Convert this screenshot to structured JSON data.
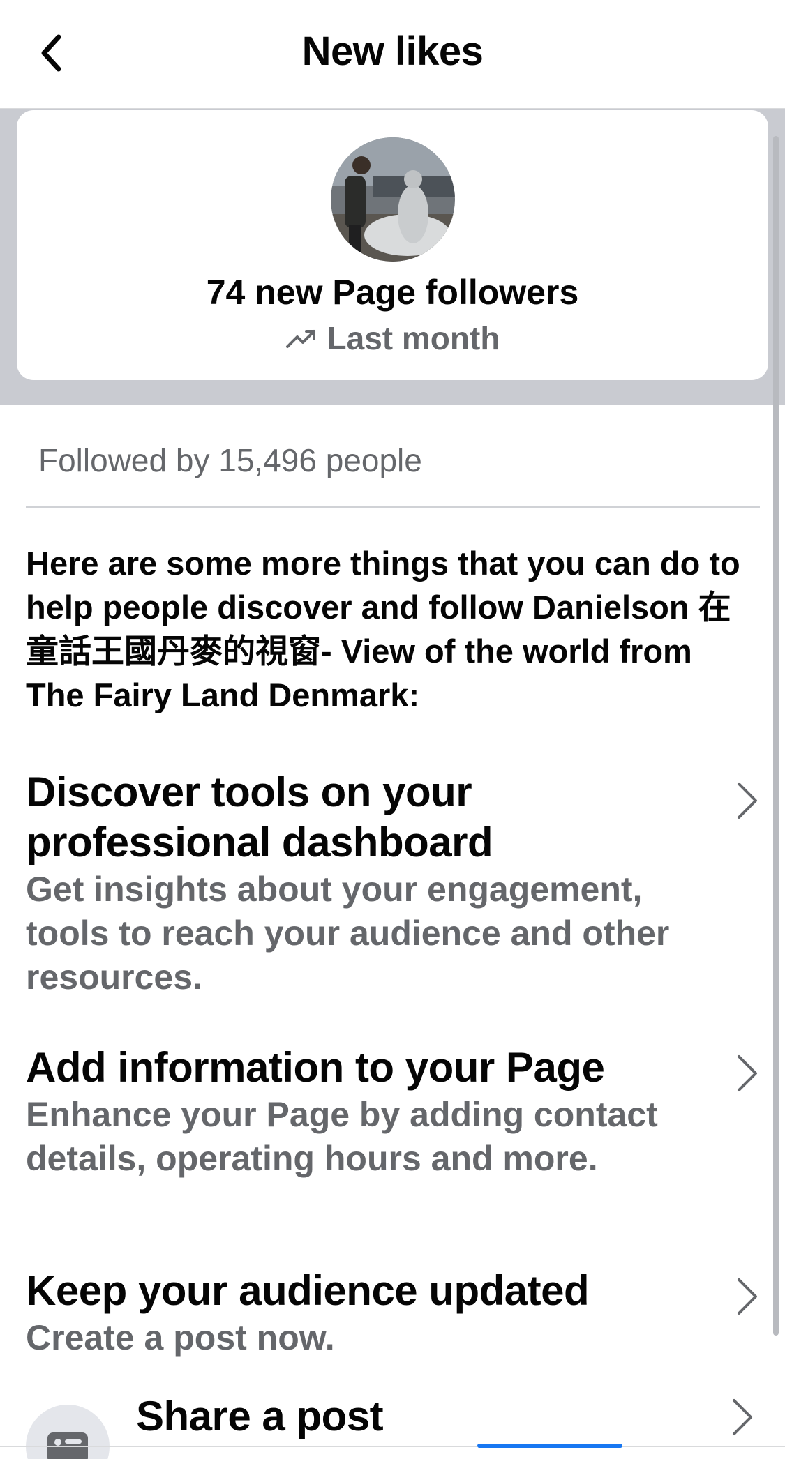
{
  "header": {
    "title": "New likes",
    "back_icon": "chevron-left-icon"
  },
  "summary": {
    "title": "74 new Page followers",
    "period_icon": "trending-up-icon",
    "period": "Last month"
  },
  "followed_by": "Followed by 15,496 people",
  "intro": "Here are some more things that you can do to help people discover and follow Danielson 在童話王國丹麥的視窗- View of the world from The Fairy Land Denmark:",
  "actions": [
    {
      "title": "Discover tools on your professional dashboard",
      "description": "Get insights about your engagement, tools to reach your audience and other resources."
    },
    {
      "title": "Add information to your Page",
      "description": "Enhance your Page by adding contact details, operating hours and more."
    },
    {
      "title": "Keep your audience updated",
      "description": "Create a post now."
    }
  ],
  "share": {
    "title": "Share a post",
    "icon": "post-icon"
  },
  "colors": {
    "secondary_text": "#65676b",
    "band": "#c9cbd1",
    "accent": "#1877f2"
  }
}
